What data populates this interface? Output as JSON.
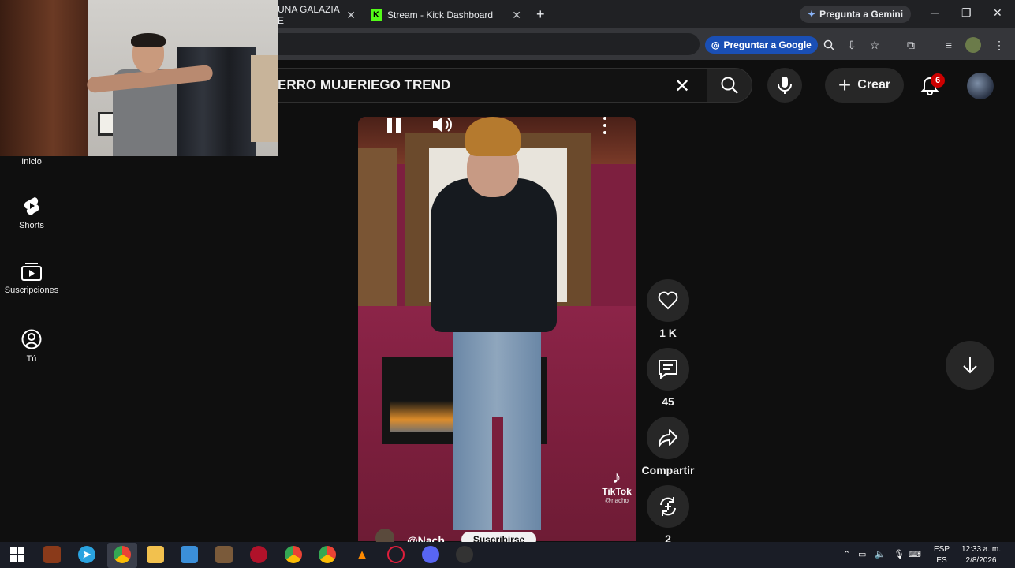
{
  "browser": {
    "tabs": [
      {
        "title": "UNA GALAZIA E"
      },
      {
        "title": "Stream - Kick Dashboard",
        "icon_letter": "K"
      }
    ],
    "new_tab": "+",
    "gemini_label": "Pregunta a Gemini",
    "ask_google_label": "Preguntar a Google"
  },
  "youtube": {
    "search_query": "ERRO MUJERIEGO TREND",
    "create_label": "Crear",
    "notification_count": "6",
    "sidebar": [
      {
        "label": "Inicio",
        "icon": "home-icon"
      },
      {
        "label": "Shorts",
        "icon": "shorts-icon"
      },
      {
        "label": "Suscripciones",
        "icon": "subscriptions-icon"
      },
      {
        "label": "Tú",
        "icon": "you-icon"
      }
    ],
    "short": {
      "watermark_brand": "TikTok",
      "watermark_user": "@nacho",
      "channel_handle": "@Nach",
      "subscribe_label": "Suscribirse"
    },
    "actions": {
      "likes": "1 K",
      "comments": "45",
      "share_label": "Compartir",
      "remix_count": "2"
    }
  },
  "taskbar": {
    "language_top": "ESP",
    "language_bottom": "ES",
    "time": "12:33 a. m.",
    "date": "2/8/2026"
  },
  "colors": {
    "yt_background": "#0f0f0f",
    "button_surface": "#272727",
    "kick_green": "#53fc18",
    "notification_red": "#cc0000",
    "ask_google_blue": "#1a4fb5"
  }
}
